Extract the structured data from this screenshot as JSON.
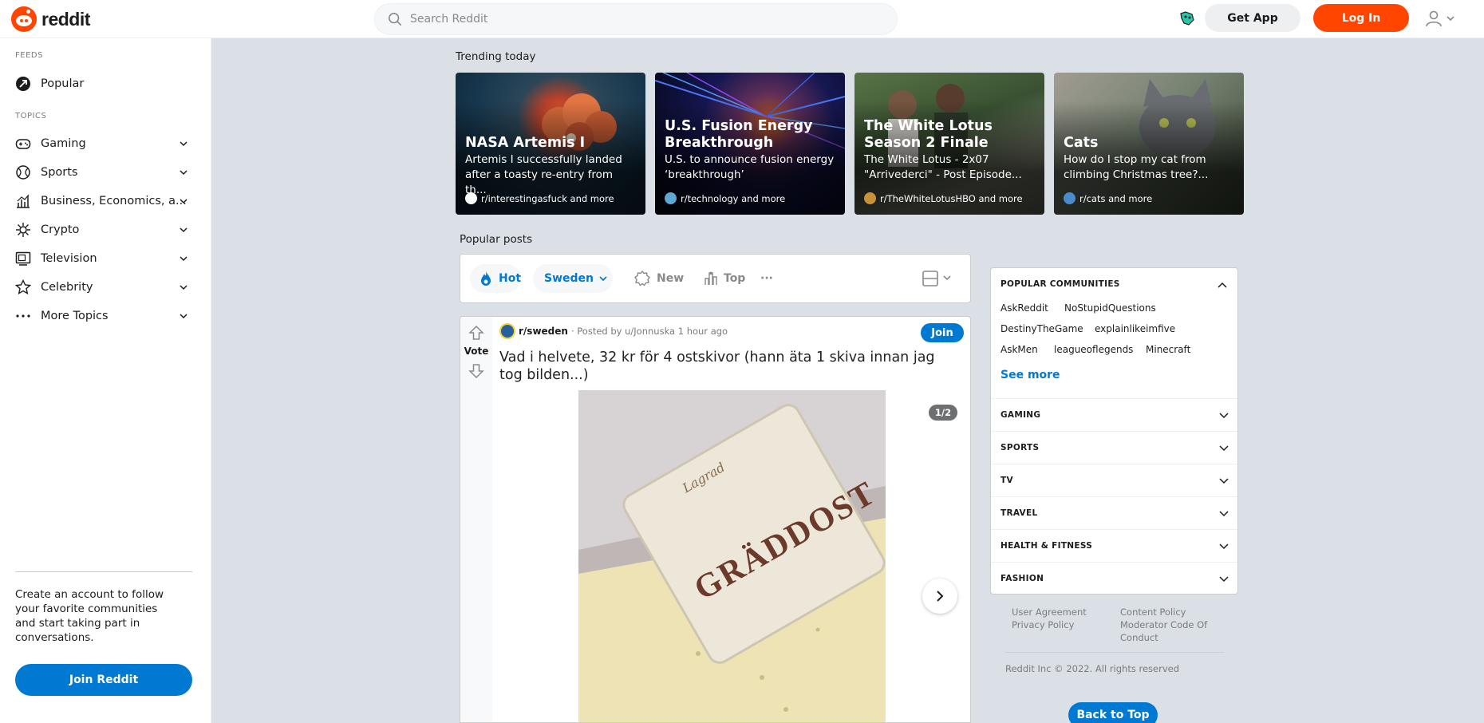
{
  "header": {
    "logo_text": "reddit",
    "search_placeholder": "Search Reddit",
    "get_app_label": "Get App",
    "login_label": "Log In"
  },
  "sidebar": {
    "feeds_label": "FEEDS",
    "popular_label": "Popular",
    "topics_label": "TOPICS",
    "topics": [
      {
        "label": "Gaming",
        "icon": "gamepad-icon"
      },
      {
        "label": "Sports",
        "icon": "ball-icon"
      },
      {
        "label": "Business, Economics, a...",
        "icon": "chart-icon"
      },
      {
        "label": "Crypto",
        "icon": "crypto-icon"
      },
      {
        "label": "Television",
        "icon": "tv-icon"
      },
      {
        "label": "Celebrity",
        "icon": "star-icon"
      },
      {
        "label": "More Topics",
        "icon": "ellipsis-icon"
      }
    ],
    "cta_text": "Create an account to follow your favorite communities and start taking part in conversations.",
    "join_label": "Join Reddit"
  },
  "trending": {
    "title": "Trending today",
    "cards": [
      {
        "title": "NASA Artemis I",
        "desc": "Artemis I successfully landed after a toasty re-entry from th...",
        "sub": "r/interestingasfuck and more"
      },
      {
        "title": "U.S. Fusion Energy Breakthrough",
        "desc": "U.S. to announce fusion energy ‘breakthrough’",
        "sub": "r/technology and more"
      },
      {
        "title": "The White Lotus Season 2 Finale",
        "desc": "The White Lotus - 2x07 \"Arrivederci\" - Post Episode...",
        "sub": "r/TheWhiteLotusHBO and more"
      },
      {
        "title": "Cats",
        "desc": "How do I stop my cat from climbing Christmas tree?...",
        "sub": "r/cats and more"
      }
    ]
  },
  "popular": {
    "title": "Popular posts",
    "sort": {
      "hot": "Hot",
      "region": "Sweden",
      "new": "New",
      "top": "Top",
      "more": "···"
    }
  },
  "post": {
    "subreddit": "r/sweden",
    "meta": "· Posted by u/Jonnuska 1 hour ago",
    "join_label": "Join",
    "vote_label": "Vote",
    "title": "Vad i helvete, 32 kr för 4 ostskivor (hann äta 1 skiva innan jag tog bilden...)",
    "image_counter": "1/2",
    "image_text_main": "GRÄDDOST",
    "image_text_script": "Lagrad"
  },
  "communities": {
    "heading": "POPULAR COMMUNITIES",
    "links": [
      "AskReddit",
      "NoStupidQuestions",
      "DestinyTheGame",
      "explainlikeimfive",
      "AskMen",
      "leagueoflegends",
      "Minecraft"
    ],
    "see_more": "See more",
    "sections": [
      "GAMING",
      "SPORTS",
      "TV",
      "TRAVEL",
      "HEALTH & FITNESS",
      "FASHION"
    ]
  },
  "footer": {
    "user_agreement": "User Agreement",
    "content_policy": "Content Policy",
    "privacy_policy": "Privacy Policy",
    "moderator_code_1": "Moderator Code Of",
    "moderator_code_2": "Conduct",
    "copyright": "Reddit Inc © 2022. All rights reserved",
    "back_to_top": "Back to Top"
  },
  "colors": {
    "brand": "#ff4500",
    "accent": "#0079d3",
    "page_bg": "#dae0e6"
  }
}
